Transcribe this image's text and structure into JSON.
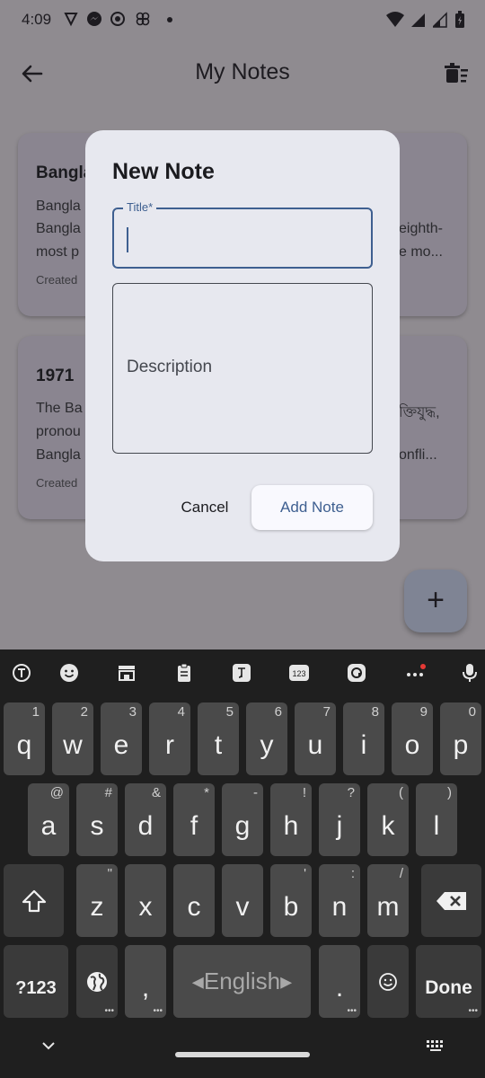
{
  "status": {
    "time": "4:09"
  },
  "appbar": {
    "title": "My Notes"
  },
  "cards": [
    {
      "title": "Bangla",
      "left_lines": [
        "Bangla",
        "Bangla",
        "most p"
      ],
      "right_lines": [
        "eighth-",
        "e mo..."
      ],
      "created": "Created"
    },
    {
      "title": "1971",
      "left_lines": [
        "The Ba",
        "pronou",
        "Bangla"
      ],
      "right_lines": [
        "ক্তিযুদ্ধ,",
        "onfli..."
      ],
      "created": "Created"
    }
  ],
  "fab": {
    "icon": "plus-icon",
    "glyph": "+"
  },
  "dialog": {
    "title": "New Note",
    "title_field_label": "Title*",
    "title_field_value": "",
    "description_placeholder": "Description",
    "cancel_label": "Cancel",
    "add_label": "Add Note"
  },
  "keyboard": {
    "row1": [
      {
        "key": "q",
        "hint": "1"
      },
      {
        "key": "w",
        "hint": "2"
      },
      {
        "key": "e",
        "hint": "3"
      },
      {
        "key": "r",
        "hint": "4"
      },
      {
        "key": "t",
        "hint": "5"
      },
      {
        "key": "y",
        "hint": "6"
      },
      {
        "key": "u",
        "hint": "7"
      },
      {
        "key": "i",
        "hint": "8"
      },
      {
        "key": "o",
        "hint": "9"
      },
      {
        "key": "p",
        "hint": "0"
      }
    ],
    "row2": [
      {
        "key": "a",
        "hint": "@"
      },
      {
        "key": "s",
        "hint": "#"
      },
      {
        "key": "d",
        "hint": "&"
      },
      {
        "key": "f",
        "hint": "*"
      },
      {
        "key": "g",
        "hint": "-"
      },
      {
        "key": "h",
        "hint": "!"
      },
      {
        "key": "j",
        "hint": "?"
      },
      {
        "key": "k",
        "hint": "("
      },
      {
        "key": "l",
        "hint": ")"
      }
    ],
    "row3": [
      {
        "key": "z",
        "hint": "\""
      },
      {
        "key": "x",
        "hint": ""
      },
      {
        "key": "c",
        "hint": ""
      },
      {
        "key": "v",
        "hint": ""
      },
      {
        "key": "b",
        "hint": "'"
      },
      {
        "key": "n",
        "hint": ":"
      },
      {
        "key": "m",
        "hint": "/"
      }
    ],
    "symbols_label": "?123",
    "comma_label": ",",
    "space_label": "English",
    "period_label": ".",
    "done_label": "Done",
    "toolbar_icons": [
      "text-cursor-icon",
      "emoji-icon",
      "store-icon",
      "clipboard-icon",
      "translate-icon",
      "numpad-icon",
      "sticker-icon",
      "more-icon",
      "mic-icon"
    ],
    "toolbar_numpad_label": "123"
  }
}
